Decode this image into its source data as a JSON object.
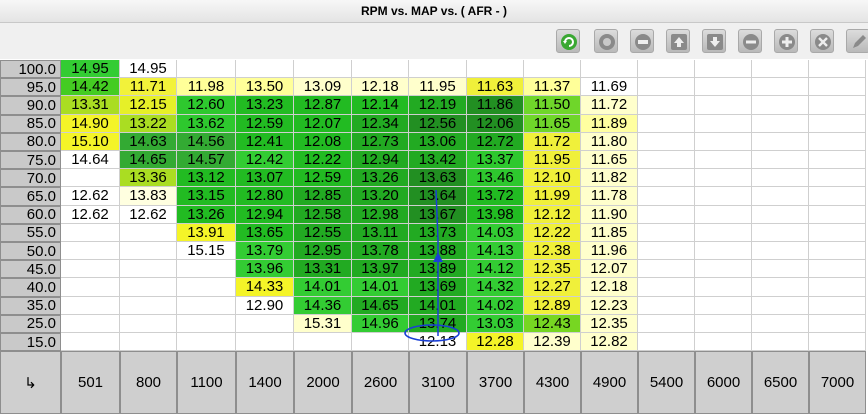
{
  "window": {
    "title": "RPM vs. MAP vs. ( AFR -   )"
  },
  "toolbar": {
    "buttons": [
      {
        "name": "refresh-icon",
        "color": "#3aa832"
      },
      {
        "name": "disc-icon",
        "color": "#8a8a8a"
      },
      {
        "name": "minus-circle-icon",
        "color": "#8a8a8a"
      },
      {
        "name": "arrow-up-icon",
        "color": "#8a8a8a"
      },
      {
        "name": "arrow-down-icon",
        "color": "#8a8a8a"
      },
      {
        "name": "remove-icon",
        "color": "#8a8a8a"
      },
      {
        "name": "add-icon",
        "color": "#8a8a8a"
      },
      {
        "name": "close-icon",
        "color": "#8a8a8a"
      },
      {
        "name": "pencil-icon",
        "color": "#8a8a8a"
      }
    ]
  },
  "table": {
    "rows": [
      "100.0",
      "95.0",
      "90.0",
      "85.0",
      "80.0",
      "75.0",
      "70.0",
      "65.0",
      "60.0",
      "55.0",
      "50.0",
      "45.0",
      "40.0",
      "35.0",
      "25.0",
      "15.0"
    ],
    "cols": [
      "501",
      "800",
      "1100",
      "1400",
      "2000",
      "2600",
      "3100",
      "3700",
      "4300",
      "4900",
      "5400",
      "6000",
      "6500",
      "7000"
    ],
    "corner_label": "↳",
    "cells": [
      [
        "14.95",
        "14.95",
        "",
        "",
        "",
        "",
        "",
        "",
        "",
        "",
        "",
        "",
        "",
        ""
      ],
      [
        "14.42",
        "11.71",
        "11.98",
        "13.50",
        "13.09",
        "12.18",
        "11.95",
        "11.63",
        "11.37",
        "11.69",
        "",
        "",
        "",
        ""
      ],
      [
        "13.31",
        "12.15",
        "12.60",
        "13.23",
        "12.87",
        "12.14",
        "12.19",
        "11.86",
        "11.50",
        "11.72",
        "",
        "",
        "",
        ""
      ],
      [
        "14.90",
        "13.22",
        "13.62",
        "12.59",
        "12.07",
        "12.34",
        "12.56",
        "12.06",
        "11.65",
        "11.89",
        "",
        "",
        "",
        ""
      ],
      [
        "15.10",
        "14.63",
        "14.56",
        "12.41",
        "12.08",
        "12.73",
        "13.06",
        "12.72",
        "11.72",
        "11.80",
        "",
        "",
        "",
        ""
      ],
      [
        "14.64",
        "14.65",
        "14.57",
        "12.42",
        "12.22",
        "12.94",
        "13.42",
        "13.37",
        "11.95",
        "11.65",
        "",
        "",
        "",
        ""
      ],
      [
        "",
        "13.36",
        "13.12",
        "13.07",
        "12.59",
        "13.26",
        "13.63",
        "13.46",
        "12.10",
        "11.82",
        "",
        "",
        "",
        ""
      ],
      [
        "12.62",
        "13.83",
        "13.15",
        "12.80",
        "12.85",
        "13.20",
        "13.64",
        "13.72",
        "11.99",
        "11.78",
        "",
        "",
        "",
        ""
      ],
      [
        "12.62",
        "12.62",
        "13.26",
        "12.94",
        "12.58",
        "12.98",
        "13.67",
        "13.98",
        "12.12",
        "11.90",
        "",
        "",
        "",
        ""
      ],
      [
        "",
        "",
        "13.91",
        "13.65",
        "12.55",
        "13.11",
        "13.73",
        "14.03",
        "12.22",
        "11.85",
        "",
        "",
        "",
        ""
      ],
      [
        "",
        "",
        "15.15",
        "13.79",
        "12.95",
        "13.78",
        "13.88",
        "14.13",
        "12.38",
        "11.96",
        "",
        "",
        "",
        ""
      ],
      [
        "",
        "",
        "",
        "13.96",
        "13.31",
        "13.97",
        "13.89",
        "14.12",
        "12.35",
        "12.07",
        "",
        "",
        "",
        ""
      ],
      [
        "",
        "",
        "",
        "14.33",
        "14.01",
        "14.01",
        "13.69",
        "14.32",
        "12.27",
        "12.18",
        "",
        "",
        "",
        ""
      ],
      [
        "",
        "",
        "",
        "12.90",
        "14.36",
        "14.65",
        "14.01",
        "14.02",
        "12.89",
        "12.23",
        "",
        "",
        "",
        ""
      ],
      [
        "",
        "",
        "",
        "",
        "15.31",
        "14.96",
        "13.74",
        "13.03",
        "12.43",
        "12.35",
        "",
        "",
        "",
        ""
      ],
      [
        "",
        "",
        "",
        "",
        "",
        "",
        "12.13",
        "12.28",
        "12.39",
        "12.82",
        "",
        "",
        "",
        ""
      ]
    ],
    "colors": [
      [
        "#33cc33",
        "#ffffff",
        "#ffffff",
        "#ffffff",
        "#ffffff",
        "#ffffff",
        "#ffffff",
        "#ffffff",
        "#ffffff",
        "#ffffff",
        "#ffffff",
        "#ffffff",
        "#ffffff",
        "#ffffff"
      ],
      [
        "#44cc22",
        "#f2f23a",
        "#ffff99",
        "#ffff99",
        "#ffffcc",
        "#ffffcc",
        "#ffffcc",
        "#f0f03a",
        "#ffff99",
        "#ffffff",
        "#ffffff",
        "#ffffff",
        "#ffffff",
        "#ffffff"
      ],
      [
        "#aadd22",
        "#e6f028",
        "#2ec82e",
        "#22bb22",
        "#22bb22",
        "#22bb22",
        "#22aa22",
        "#228f22",
        "#6fd62a",
        "#ffffcc",
        "#ffffff",
        "#ffffff",
        "#ffffff",
        "#ffffff"
      ],
      [
        "#f4f428",
        "#aadd22",
        "#2ec82e",
        "#22bb22",
        "#22bb22",
        "#22aa22",
        "#228f22",
        "#228f22",
        "#6fd62a",
        "#ffffa0",
        "#ffffff",
        "#ffffff",
        "#ffffff",
        "#ffffff"
      ],
      [
        "#f4f428",
        "#33aa33",
        "#33aa33",
        "#22bb22",
        "#22bb22",
        "#22aa22",
        "#22aa22",
        "#22aa22",
        "#f0f03a",
        "#ffffcc",
        "#ffffff",
        "#ffffff",
        "#ffffff",
        "#ffffff"
      ],
      [
        "#ffffff",
        "#33aa33",
        "#33aa33",
        "#33cc33",
        "#22bb22",
        "#22aa22",
        "#22aa22",
        "#2ec82e",
        "#f0f03a",
        "#ffffcc",
        "#ffffff",
        "#ffffff",
        "#ffffff",
        "#ffffff"
      ],
      [
        "#ffffff",
        "#aadd22",
        "#22bb22",
        "#22bb22",
        "#22bb22",
        "#22aa22",
        "#228f22",
        "#2ec82e",
        "#f0f03a",
        "#ffffcc",
        "#ffffff",
        "#ffffff",
        "#ffffff",
        "#ffffff"
      ],
      [
        "#ffffff",
        "#ffffe0",
        "#22bb22",
        "#22bb22",
        "#22aa22",
        "#22aa22",
        "#228f22",
        "#22bb22",
        "#f0f03a",
        "#ffffcc",
        "#ffffff",
        "#ffffff",
        "#ffffff",
        "#ffffff"
      ],
      [
        "#ffffff",
        "#ffffff",
        "#22bb22",
        "#22bb22",
        "#22aa22",
        "#22aa22",
        "#228f22",
        "#22bb22",
        "#f0f03a",
        "#ffffcc",
        "#ffffff",
        "#ffffff",
        "#ffffff",
        "#ffffff"
      ],
      [
        "#ffffff",
        "#ffffff",
        "#f4f428",
        "#22bb22",
        "#22aa22",
        "#22aa22",
        "#22aa22",
        "#33cc33",
        "#f0f03a",
        "#ffffcc",
        "#ffffff",
        "#ffffff",
        "#ffffff",
        "#ffffff"
      ],
      [
        "#ffffff",
        "#ffffff",
        "#ffffff",
        "#33cc33",
        "#22aa22",
        "#22aa22",
        "#22aa22",
        "#33cc33",
        "#f0f03a",
        "#ffffcc",
        "#ffffff",
        "#ffffff",
        "#ffffff",
        "#ffffff"
      ],
      [
        "#ffffff",
        "#ffffff",
        "#ffffff",
        "#33cc33",
        "#22aa22",
        "#22aa22",
        "#22aa22",
        "#33cc33",
        "#f0f03a",
        "#ffffcc",
        "#ffffff",
        "#ffffff",
        "#ffffff",
        "#ffffff"
      ],
      [
        "#ffffff",
        "#ffffff",
        "#ffffff",
        "#f4f428",
        "#33cc33",
        "#33cc33",
        "#22aa22",
        "#33cc33",
        "#f0f03a",
        "#ffffcc",
        "#ffffff",
        "#ffffff",
        "#ffffff",
        "#ffffff"
      ],
      [
        "#ffffff",
        "#ffffff",
        "#ffffff",
        "#ffffff",
        "#33cc33",
        "#22aa22",
        "#22aa22",
        "#33cc33",
        "#f0f03a",
        "#ffffcc",
        "#ffffff",
        "#ffffff",
        "#ffffff",
        "#ffffff"
      ],
      [
        "#ffffff",
        "#ffffff",
        "#ffffff",
        "#ffffff",
        "#ffffcc",
        "#33cc33",
        "#22aa22",
        "#33cc33",
        "#77d622",
        "#ffffcc",
        "#ffffff",
        "#ffffff",
        "#ffffff",
        "#ffffff"
      ],
      [
        "#ffffff",
        "#ffffff",
        "#ffffff",
        "#ffffff",
        "#ffffff",
        "#ffffff",
        "#ffffff",
        "#f4f428",
        "#ffffcc",
        "#ffffcc",
        "#ffffff",
        "#ffffff",
        "#ffffff",
        "#ffffff"
      ]
    ]
  },
  "trace": {
    "color": "#1a3fd6"
  }
}
